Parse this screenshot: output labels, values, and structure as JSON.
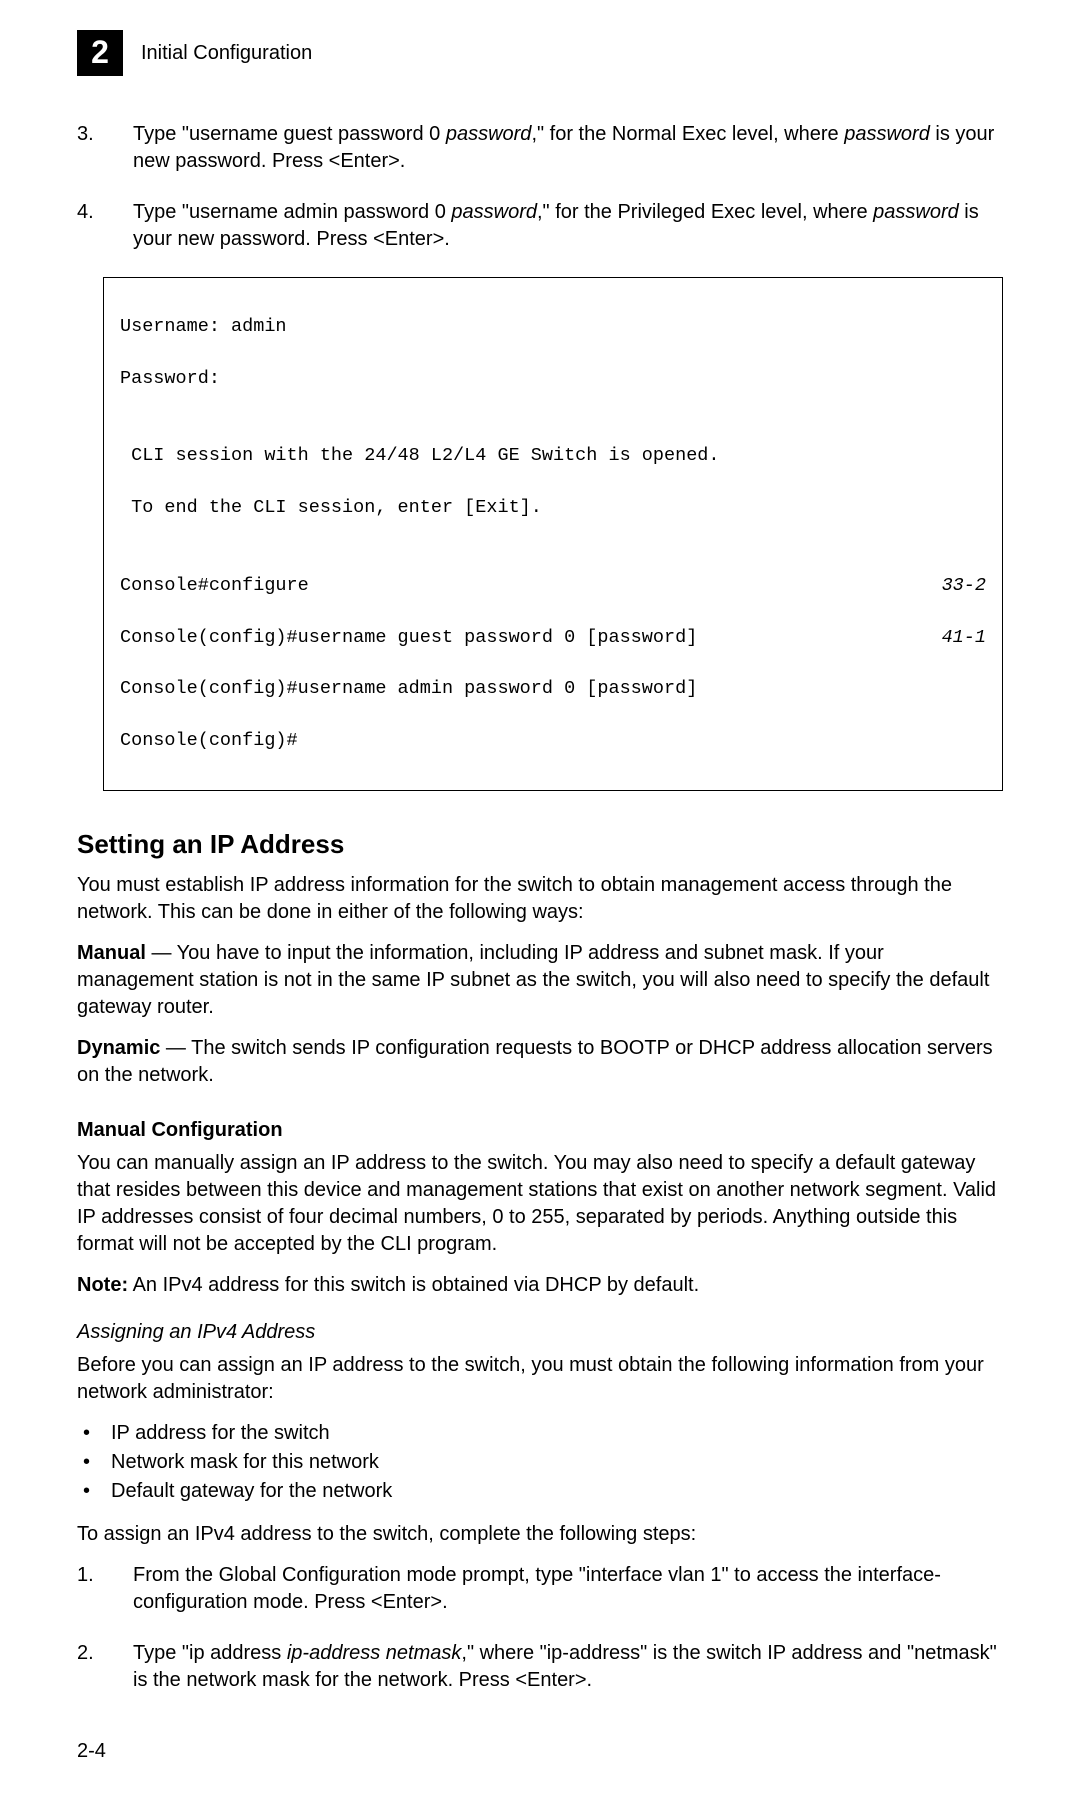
{
  "header": {
    "chapter_number": "2",
    "title": "Initial Configuration"
  },
  "steps_top": [
    {
      "num": "3.",
      "parts": [
        "Type \"username guest password 0 ",
        "password",
        ",\" for the Normal Exec level, where ",
        "password",
        " is your new password. Press <Enter>."
      ]
    },
    {
      "num": "4.",
      "parts": [
        "Type \"username admin password 0 ",
        "password",
        ",\" for the Privileged Exec level, where ",
        "password",
        " is your new password. Press <Enter>."
      ]
    }
  ],
  "code": {
    "l1": "Username: admin",
    "l2": "Password:",
    "blank1": "",
    "l3": " CLI session with the 24/48 L2/L4 GE Switch is opened.",
    "l4": " To end the CLI session, enter [Exit].",
    "blank2": "",
    "l5": "Console#configure",
    "r5": "33-2",
    "l6": "Console(config)#username guest password 0 [password]",
    "r6": "41-1",
    "l7": "Console(config)#username admin password 0 [password]",
    "l8": "Console(config)#"
  },
  "h2": "Setting an IP Address",
  "p_intro": "You must establish IP address information for the switch to obtain management access through the network. This can be done in either of the following ways:",
  "p_manual_label": "Manual",
  "p_manual_text": " — You have to input the information, including IP address and subnet mask. If your management station is not in the same IP subnet as the switch, you will also need to specify the default gateway router.",
  "p_dynamic_label": "Dynamic",
  "p_dynamic_text": " — The switch sends IP configuration requests to BOOTP or DHCP address allocation servers on the network.",
  "h3": "Manual Configuration",
  "p_mc": "You can manually assign an IP address to the switch. You may also need to specify a default gateway that resides between this device and management stations that exist on another network segment. Valid IP addresses consist of four decimal numbers, 0 to 255, separated by periods. Anything outside this format will not be accepted by the CLI program.",
  "p_note_label": "Note:",
  "p_note_text": "  An IPv4 address for this switch is obtained via DHCP by default.",
  "h4": "Assigning an IPv4 Address",
  "p_before": "Before you can assign an IP address to the switch, you must obtain the following information from your network administrator:",
  "bullets": [
    "IP address for the switch",
    "Network mask for this network",
    "Default gateway for the network"
  ],
  "p_toassign": "To assign an IPv4 address to the switch, complete the following steps:",
  "steps_bottom": [
    {
      "num": "1.",
      "text": "From the Global Configuration mode prompt, type \"interface vlan 1\" to access the interface-configuration mode. Press <Enter>."
    },
    {
      "num": "2.",
      "parts": [
        "Type \"ip address ",
        "ip-address netmask",
        ",\" where \"ip-address\" is the switch IP address and \"netmask\" is the network mask for the network. Press <Enter>."
      ]
    }
  ],
  "footer": "2-4"
}
